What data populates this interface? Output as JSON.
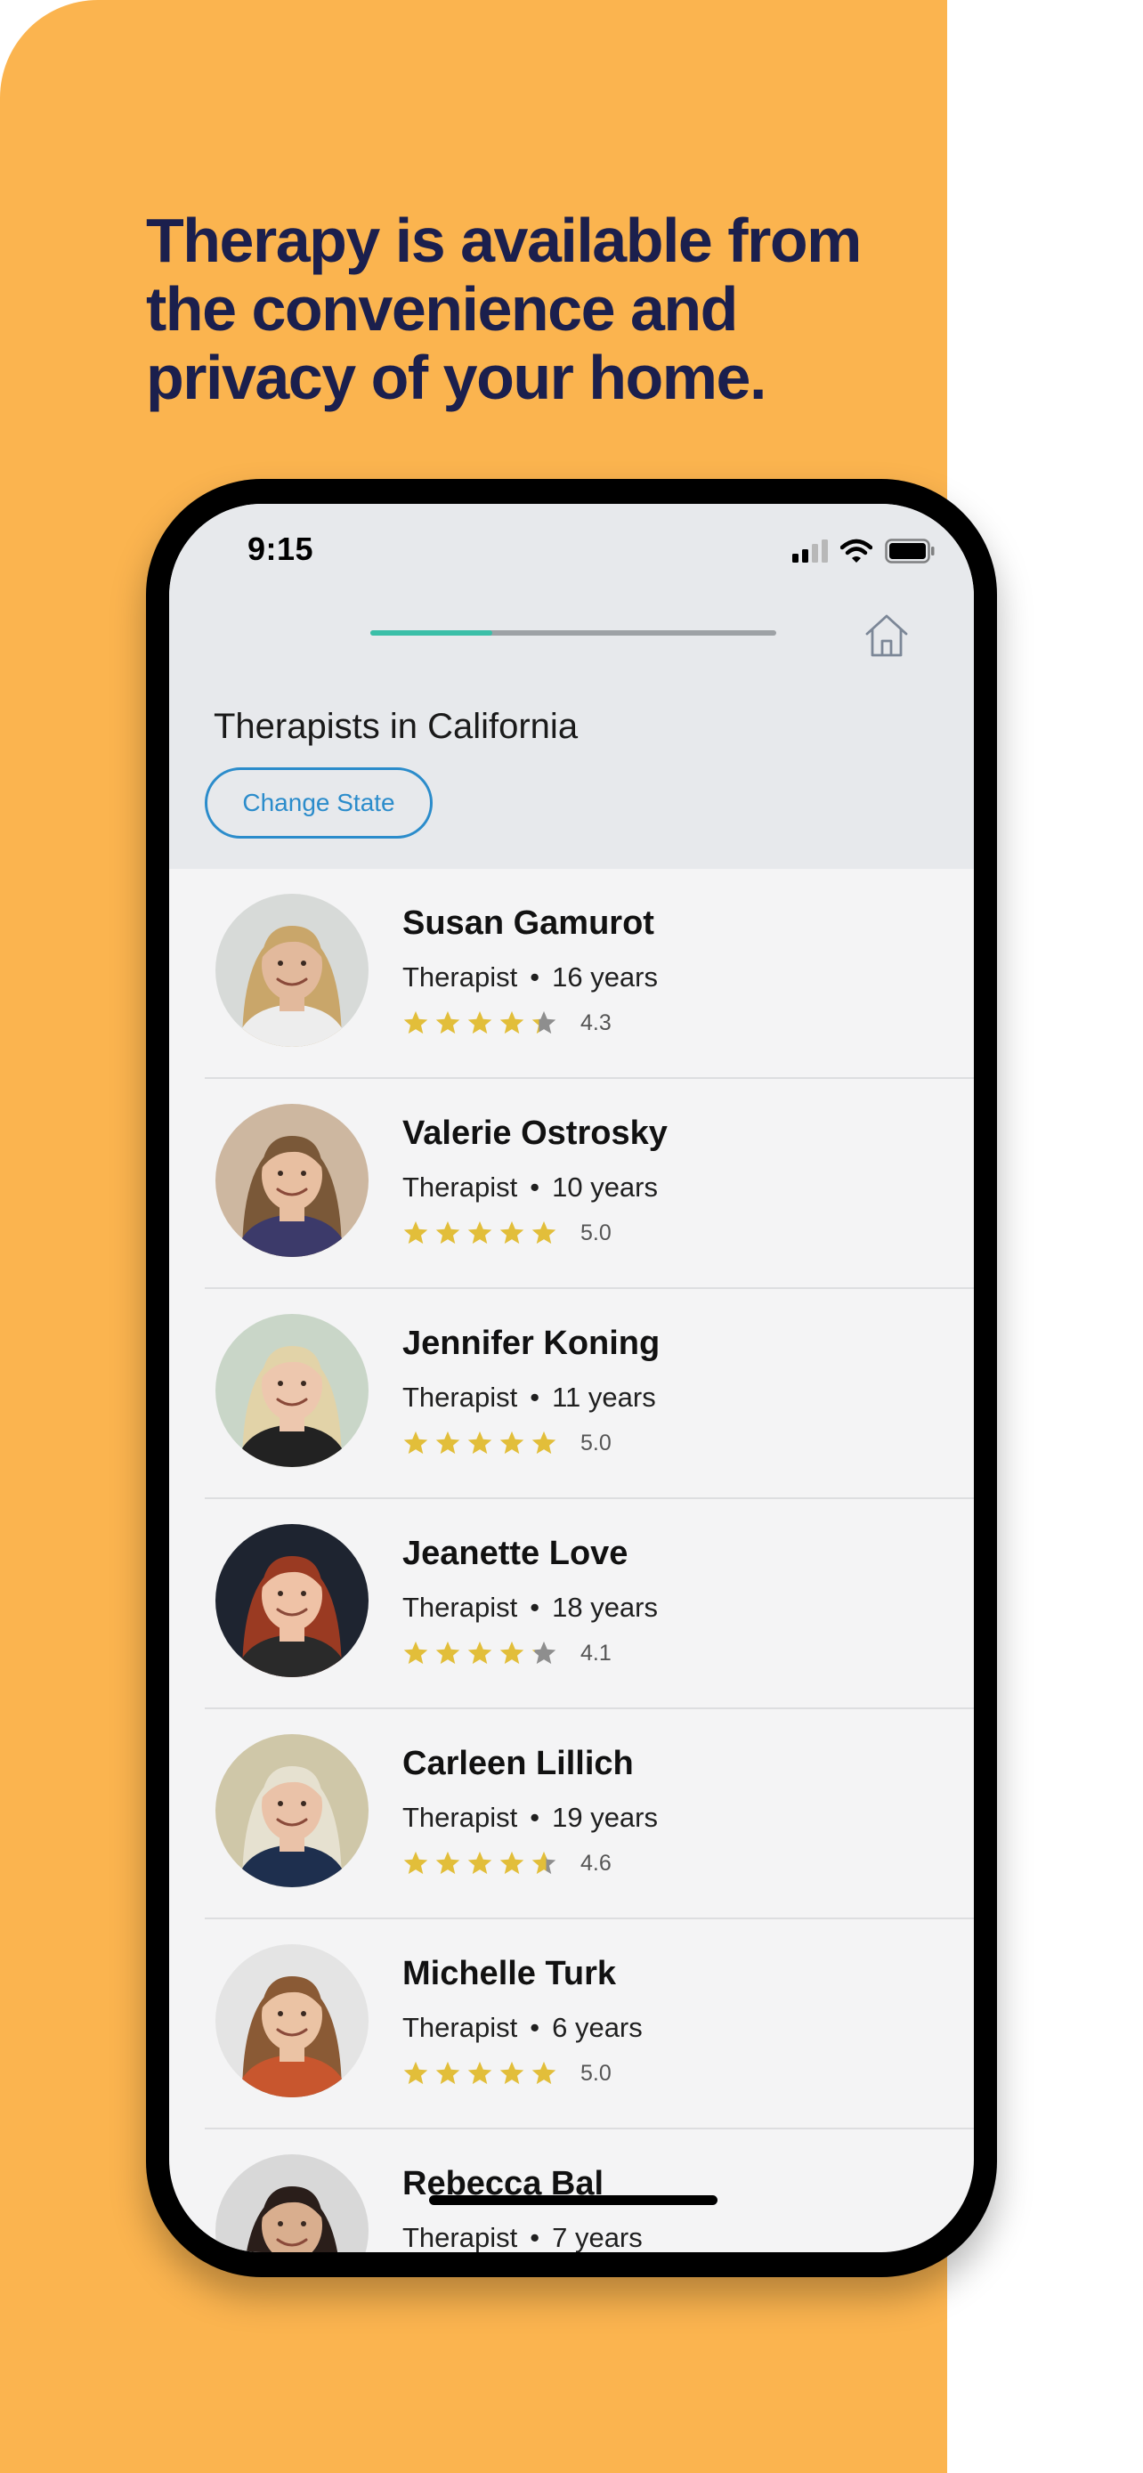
{
  "headline": {
    "line1": "Therapy is available from",
    "line2": "the convenience and",
    "line3": "privacy of your home."
  },
  "status_bar": {
    "time": "9:15"
  },
  "progress": {
    "fraction": 0.3
  },
  "list": {
    "title": "Therapists in California",
    "change_state_label": "Change State"
  },
  "therapists": [
    {
      "name": "Susan Gamurot",
      "role": "Therapist",
      "experience": "16 years",
      "rating": "4.3",
      "rating_value": 4.3,
      "skin": "#E2B99C",
      "hair": "#C9A66A",
      "bg": "#D7DAD8",
      "shirt": "#EDEDED"
    },
    {
      "name": "Valerie Ostrosky",
      "role": "Therapist",
      "experience": "10 years",
      "rating": "5.0",
      "rating_value": 5.0,
      "skin": "#E8BFA1",
      "hair": "#7A5838",
      "bg": "#CDB7A0",
      "shirt": "#3C3A6A"
    },
    {
      "name": "Jennifer Koning",
      "role": "Therapist",
      "experience": "11 years",
      "rating": "5.0",
      "rating_value": 5.0,
      "skin": "#EDC7AE",
      "hair": "#E2D3A8",
      "bg": "#C9D6C8",
      "shirt": "#222222"
    },
    {
      "name": "Jeanette Love",
      "role": "Therapist",
      "experience": "18 years",
      "rating": "4.1",
      "rating_value": 4.1,
      "skin": "#EFC2A6",
      "hair": "#9A3A22",
      "bg": "#1E2430",
      "shirt": "#2A2A2A"
    },
    {
      "name": "Carleen Lillich",
      "role": "Therapist",
      "experience": "19 years",
      "rating": "4.6",
      "rating_value": 4.6,
      "skin": "#EAC2A8",
      "hair": "#E6E1D0",
      "bg": "#CFC7A8",
      "shirt": "#1E2F4E"
    },
    {
      "name": "Michelle Turk",
      "role": "Therapist",
      "experience": "6 years",
      "rating": "5.0",
      "rating_value": 5.0,
      "skin": "#EBC3A4",
      "hair": "#8A5A35",
      "bg": "#E4E4E4",
      "shirt": "#C8562E"
    },
    {
      "name": "Rebecca Bal",
      "role": "Therapist",
      "experience": "7 years",
      "rating": "",
      "rating_value": 0,
      "skin": "#D9AE8E",
      "hair": "#2A1E1A",
      "bg": "#D8D8D8",
      "shirt": "#444444"
    }
  ],
  "colors": {
    "star_filled": "#E2BE3A",
    "star_empty": "#8E8E8E",
    "accent": "#2B8CCB",
    "progress": "#3BBFA8",
    "brand_bg": "#FBB44F"
  },
  "icons": [
    "cellular-signal-icon",
    "wifi-icon",
    "battery-icon",
    "home-icon",
    "star-icon"
  ]
}
